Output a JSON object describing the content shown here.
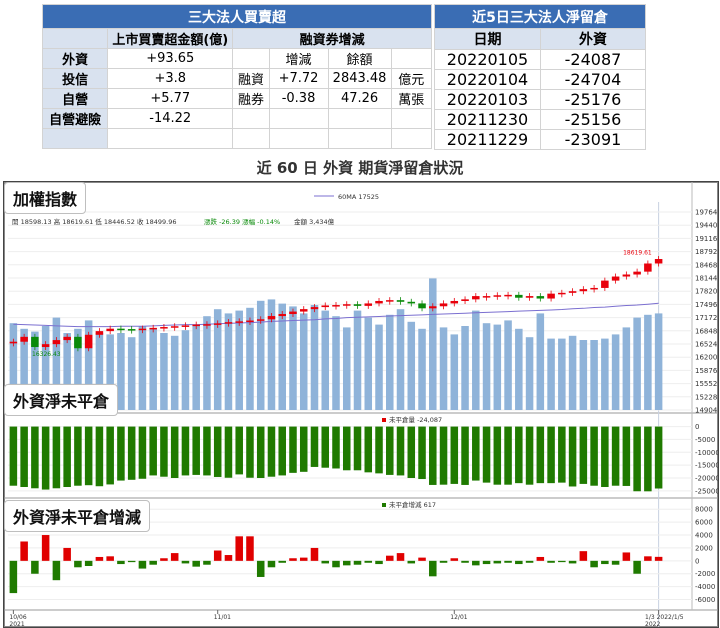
{
  "summary_table": {
    "title": "三大法人買賣超",
    "col1": "上市買賣超金額(億)",
    "col2": "融資券增減",
    "sub_change": "增減",
    "sub_balance": "餘額",
    "rows": [
      {
        "label": "外資",
        "value": "+93.65",
        "t": "",
        "chg": "",
        "bal": "",
        "unit": ""
      },
      {
        "label": "投信",
        "value": "+3.8",
        "t": "融資",
        "chg": "+7.72",
        "bal": "2843.48",
        "unit": "億元"
      },
      {
        "label": "自營",
        "value": "+5.77",
        "t": "融券",
        "chg": "-0.38",
        "bal": "47.26",
        "unit": "萬張"
      },
      {
        "label": "自營避險",
        "value": "-14.22",
        "t": "",
        "chg": "",
        "bal": "",
        "unit": ""
      },
      {
        "label": "",
        "value": "",
        "t": "",
        "chg": "",
        "bal": "",
        "unit": ""
      }
    ]
  },
  "foreign_table": {
    "title": "近5日三大法人淨留倉",
    "col_date": "日期",
    "col_value": "外資",
    "rows": [
      {
        "date": "20220105",
        "value": "-24087"
      },
      {
        "date": "20220104",
        "value": "-24704"
      },
      {
        "date": "20220103",
        "value": "-25176"
      },
      {
        "date": "20211230",
        "value": "-25156"
      },
      {
        "date": "20211229",
        "value": "-23091"
      }
    ]
  },
  "subtitle": "近 60 日 外資 期貨淨留倉狀況",
  "colors": {
    "up": "#e8000b",
    "down": "#0a8a0a",
    "volume": "#8fb3d9",
    "ma": "#7b6fd0",
    "bar_green": "#1f7a00",
    "bar_red": "#e00000"
  },
  "chart_data": [
    {
      "type": "candlestick",
      "title": "加權指數",
      "info": "開 18598.13  高 18619.61  低 18446.52  收 18499.96",
      "change": "漲跌 -26.39  漲幅 -0.14%",
      "amount": "金額 3,434億",
      "ma_label": "60MA 17525",
      "last_label": "18619.61",
      "low_label": "16326.43",
      "yticks": [
        19764,
        19440,
        19116,
        18792,
        18468,
        18144,
        17820,
        17496,
        17172,
        16848,
        16524,
        16200,
        15876,
        15552,
        15228,
        14904
      ],
      "ylim": [
        14904,
        19764
      ],
      "close": [
        16580,
        16700,
        16450,
        16520,
        16620,
        16700,
        16420,
        16750,
        16840,
        16900,
        16890,
        16880,
        16900,
        16920,
        16940,
        16960,
        16980,
        17000,
        17010,
        17030,
        17060,
        17080,
        17100,
        17130,
        17210,
        17260,
        17320,
        17380,
        17430,
        17470,
        17480,
        17500,
        17460,
        17520,
        17580,
        17600,
        17560,
        17520,
        17400,
        17450,
        17520,
        17580,
        17620,
        17700,
        17700,
        17720,
        17730,
        17660,
        17700,
        17640,
        17760,
        17780,
        17820,
        17870,
        17900,
        18080,
        18180,
        18230,
        18300,
        18500,
        18610
      ],
      "ma60": [
        17010,
        17000,
        16990,
        16980,
        16970,
        16960,
        16950,
        16950,
        16950,
        16950,
        16960,
        16960,
        16960,
        16970,
        16980,
        16990,
        17000,
        17000,
        17010,
        17020,
        17030,
        17040,
        17050,
        17060,
        17080,
        17090,
        17100,
        17110,
        17120,
        17140,
        17150,
        17170,
        17180,
        17190,
        17200,
        17210,
        17220,
        17230,
        17240,
        17250,
        17260,
        17270,
        17280,
        17290,
        17300,
        17310,
        17320,
        17330,
        17340,
        17350,
        17360,
        17370,
        17390,
        17400,
        17420,
        17430,
        17450,
        17470,
        17480,
        17500,
        17525
      ],
      "volume": [
        0.62,
        0.58,
        0.56,
        0.6,
        0.66,
        0.55,
        0.58,
        0.64,
        0.55,
        0.54,
        0.55,
        0.52,
        0.6,
        0.58,
        0.55,
        0.53,
        0.57,
        0.6,
        0.67,
        0.72,
        0.69,
        0.71,
        0.73,
        0.78,
        0.79,
        0.76,
        0.74,
        0.69,
        0.75,
        0.71,
        0.67,
        0.59,
        0.71,
        0.66,
        0.61,
        0.68,
        0.72,
        0.63,
        0.58,
        0.94,
        0.59,
        0.54,
        0.6,
        0.71,
        0.62,
        0.61,
        0.64,
        0.58,
        0.52,
        0.69,
        0.51,
        0.51,
        0.53,
        0.5,
        0.5,
        0.51,
        0.54,
        0.59,
        0.66,
        0.68,
        0.69
      ]
    },
    {
      "type": "bar",
      "title": "外資淨未平倉",
      "legend": "未平倉量 -24,087",
      "yticks": [
        0,
        -5000,
        -10000,
        -15000,
        -20000,
        -25000
      ],
      "ylim": [
        -27000,
        1000
      ],
      "values": [
        -23000,
        -23500,
        -24000,
        -24500,
        -24000,
        -23500,
        -23000,
        -22800,
        -23200,
        -22500,
        -21000,
        -20700,
        -20300,
        -19000,
        -19500,
        -20000,
        -19000,
        -18800,
        -19000,
        -19600,
        -19900,
        -18600,
        -19900,
        -20000,
        -19500,
        -19000,
        -18000,
        -17600,
        -15700,
        -16000,
        -16300,
        -17000,
        -17000,
        -17800,
        -18200,
        -18800,
        -19000,
        -20000,
        -20400,
        -22700,
        -22600,
        -22300,
        -22700,
        -21000,
        -21800,
        -22600,
        -22600,
        -22000,
        -22600,
        -22000,
        -22000,
        -21800,
        -23300,
        -22300,
        -23000,
        -23500,
        -23000,
        -23091,
        -25156,
        -25176,
        -24087
      ]
    },
    {
      "type": "bar",
      "title": "外資淨未平倉增減",
      "legend": "未平倉增減 617",
      "yticks": [
        8000,
        6000,
        4000,
        2000,
        0,
        -2000,
        -4000,
        -6000
      ],
      "ylim": [
        -7000,
        8500
      ],
      "values": [
        -5000,
        3000,
        -2000,
        4000,
        -3000,
        2000,
        -1000,
        -800,
        600,
        700,
        -500,
        -200,
        -1200,
        -600,
        400,
        1200,
        -400,
        -900,
        -600,
        1600,
        900,
        3800,
        3800,
        -2500,
        -1000,
        -300,
        400,
        500,
        2000,
        -400,
        -1000,
        -700,
        -600,
        -300,
        -500,
        800,
        1200,
        -400,
        500,
        -2400,
        -300,
        400,
        -300,
        -700,
        -500,
        -400,
        -300,
        -500,
        -300,
        600,
        -300,
        -200,
        -400,
        1500,
        -1000,
        -500,
        -600,
        1300,
        -2000,
        700,
        617
      ]
    }
  ],
  "x_labels": [
    {
      "i": 0,
      "text": "10/06",
      "sub": "2021"
    },
    {
      "i": 19,
      "text": "11/01",
      "sub": ""
    },
    {
      "i": 41,
      "text": "12/01",
      "sub": ""
    },
    {
      "i": 60,
      "text": "1/3  2022/1/5",
      "sub": "2022"
    }
  ]
}
